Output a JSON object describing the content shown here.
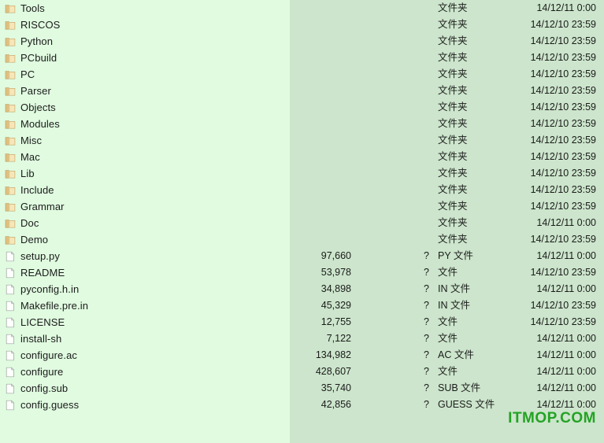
{
  "colors": {
    "left_pane_bg": "#e0fbe0",
    "right_pane_bg": "#cce5cc",
    "text": "#1b1b1b",
    "watermark": "#24a324",
    "folder_icon": "#e8c97a",
    "file_icon": "#ffffff"
  },
  "watermark": {
    "text": "ITMOP.COM"
  },
  "labels": {
    "folder_type": "文件夹",
    "unknown_size": "?"
  },
  "rows": [
    {
      "icon": "folder-icon",
      "name": "Tools",
      "size": "",
      "q": "",
      "type": "文件夹",
      "date": "14/12/11 0:00"
    },
    {
      "icon": "folder-icon",
      "name": "RISCOS",
      "size": "",
      "q": "",
      "type": "文件夹",
      "date": "14/12/10 23:59"
    },
    {
      "icon": "folder-icon",
      "name": "Python",
      "size": "",
      "q": "",
      "type": "文件夹",
      "date": "14/12/10 23:59"
    },
    {
      "icon": "folder-icon",
      "name": "PCbuild",
      "size": "",
      "q": "",
      "type": "文件夹",
      "date": "14/12/10 23:59"
    },
    {
      "icon": "folder-icon",
      "name": "PC",
      "size": "",
      "q": "",
      "type": "文件夹",
      "date": "14/12/10 23:59"
    },
    {
      "icon": "folder-icon",
      "name": "Parser",
      "size": "",
      "q": "",
      "type": "文件夹",
      "date": "14/12/10 23:59"
    },
    {
      "icon": "folder-icon",
      "name": "Objects",
      "size": "",
      "q": "",
      "type": "文件夹",
      "date": "14/12/10 23:59"
    },
    {
      "icon": "folder-icon",
      "name": "Modules",
      "size": "",
      "q": "",
      "type": "文件夹",
      "date": "14/12/10 23:59"
    },
    {
      "icon": "folder-icon",
      "name": "Misc",
      "size": "",
      "q": "",
      "type": "文件夹",
      "date": "14/12/10 23:59"
    },
    {
      "icon": "folder-icon",
      "name": "Mac",
      "size": "",
      "q": "",
      "type": "文件夹",
      "date": "14/12/10 23:59"
    },
    {
      "icon": "folder-icon",
      "name": "Lib",
      "size": "",
      "q": "",
      "type": "文件夹",
      "date": "14/12/10 23:59"
    },
    {
      "icon": "folder-icon",
      "name": "Include",
      "size": "",
      "q": "",
      "type": "文件夹",
      "date": "14/12/10 23:59"
    },
    {
      "icon": "folder-icon",
      "name": "Grammar",
      "size": "",
      "q": "",
      "type": "文件夹",
      "date": "14/12/10 23:59"
    },
    {
      "icon": "folder-icon",
      "name": "Doc",
      "size": "",
      "q": "",
      "type": "文件夹",
      "date": "14/12/11 0:00"
    },
    {
      "icon": "folder-icon",
      "name": "Demo",
      "size": "",
      "q": "",
      "type": "文件夹",
      "date": "14/12/10 23:59"
    },
    {
      "icon": "file-icon",
      "name": "setup.py",
      "size": "97,660",
      "q": "?",
      "type": "PY 文件",
      "date": "14/12/11 0:00"
    },
    {
      "icon": "file-icon",
      "name": "README",
      "size": "53,978",
      "q": "?",
      "type": "文件",
      "date": "14/12/10 23:59"
    },
    {
      "icon": "file-icon",
      "name": "pyconfig.h.in",
      "size": "34,898",
      "q": "?",
      "type": "IN 文件",
      "date": "14/12/11 0:00"
    },
    {
      "icon": "file-icon",
      "name": "Makefile.pre.in",
      "size": "45,329",
      "q": "?",
      "type": "IN 文件",
      "date": "14/12/10 23:59"
    },
    {
      "icon": "file-icon",
      "name": "LICENSE",
      "size": "12,755",
      "q": "?",
      "type": "文件",
      "date": "14/12/10 23:59"
    },
    {
      "icon": "file-icon",
      "name": "install-sh",
      "size": "7,122",
      "q": "?",
      "type": "文件",
      "date": "14/12/11 0:00"
    },
    {
      "icon": "file-icon",
      "name": "configure.ac",
      "size": "134,982",
      "q": "?",
      "type": "AC 文件",
      "date": "14/12/11 0:00"
    },
    {
      "icon": "file-icon",
      "name": "configure",
      "size": "428,607",
      "q": "?",
      "type": "文件",
      "date": "14/12/11 0:00"
    },
    {
      "icon": "file-icon",
      "name": "config.sub",
      "size": "35,740",
      "q": "?",
      "type": "SUB 文件",
      "date": "14/12/11 0:00"
    },
    {
      "icon": "file-icon",
      "name": "config.guess",
      "size": "42,856",
      "q": "?",
      "type": "GUESS 文件",
      "date": "14/12/11 0:00"
    }
  ]
}
